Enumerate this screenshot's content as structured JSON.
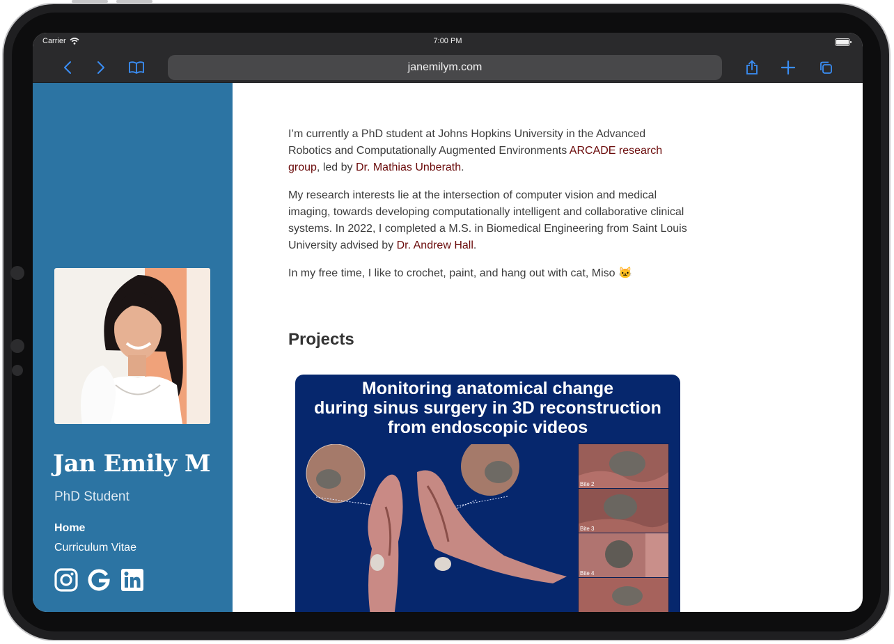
{
  "status_bar": {
    "carrier": "Carrier",
    "time": "7:00 PM"
  },
  "browser": {
    "url": "janemilym.com"
  },
  "sidebar": {
    "name": "Jan Emily M",
    "role": "PhD Student",
    "nav": [
      {
        "label": "Home",
        "active": true
      },
      {
        "label": "Curriculum Vitae",
        "active": false
      }
    ],
    "social_icons": [
      "instagram-icon",
      "google-icon",
      "linkedin-icon"
    ]
  },
  "main": {
    "intro": {
      "p1_a": "I’m currently a PhD student at Johns Hopkins University in the Advanced Robotics and Computationally Augmented Environments ",
      "p1_link1": "ARCADE research group",
      "p1_b": ", led by ",
      "p1_link2": "Dr. Mathias Unberath",
      "p1_c": ".",
      "p2_a": "My research interests lie at the intersection of computer vision and medical imaging, towards developing computationally intelligent and collaborative clinical systems. In 2022, I completed a M.S. in Biomedical Engineering from Saint Louis University advised by ",
      "p2_link": "Dr. Andrew Hall",
      "p2_b": ".",
      "p3": "In my free time, I like to crochet, paint, and hang out with cat, Miso 🐱"
    },
    "projects_heading": "Projects",
    "project": {
      "title_line1": "Monitoring anatomical change",
      "title_line2": "during sinus surgery in 3D reconstruction",
      "title_line3": "from endoscopic videos",
      "thumb_labels": [
        "Bite 2",
        "Bite 3",
        "Bite 4",
        ""
      ]
    }
  },
  "colors": {
    "sidebar": "#2c74a3",
    "link": "#6a0a0a",
    "poster_bg": "#06276d",
    "browser_chrome": "#2a2a2c",
    "accent": "#3a8ef6"
  }
}
